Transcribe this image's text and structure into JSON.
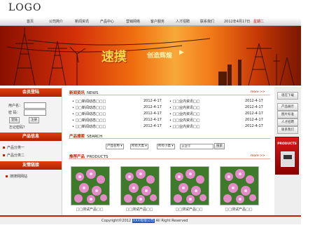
{
  "logo": "LOGO",
  "nav": {
    "items": [
      "首页",
      "公司简介",
      "新闻资讯",
      "产品中心",
      "营销网络",
      "客户服务",
      "人才招聘",
      "联系我们"
    ],
    "date": "2012年4月17日",
    "week": "星期二"
  },
  "banner": {
    "slogan_big": "速摸",
    "slogan_small": "创造辉煌",
    "arrow": "▶"
  },
  "sidebar": {
    "login": {
      "title": "会员登陆",
      "username_label": "用户名：",
      "password_label": "密 码：",
      "login_button": "登陆",
      "register_button": "注册",
      "forgot": "忘记密码？"
    },
    "products": {
      "title": "产品信息",
      "items": [
        "产品分类一",
        "产品分类二"
      ]
    },
    "links": {
      "title": "友情链接",
      "items": [
        "搜搜网网站"
      ]
    }
  },
  "news": {
    "title_cn": "新闻资讯",
    "title_en": "NEWS",
    "more": "more >>",
    "left": [
      {
        "title": "□□新闻动态□□□",
        "date": "2012-4-17"
      },
      {
        "title": "□□新闻动态□□□",
        "date": "2012-4-17"
      },
      {
        "title": "□□新闻动态□□□",
        "date": "2012-4-17"
      },
      {
        "title": "□□新闻动态□□□",
        "date": "2012-4-17"
      },
      {
        "title": "□□新闻动态□□□",
        "date": "2012-4-17"
      }
    ],
    "right": [
      {
        "title": "□□业内资讯□□",
        "date": "2012-4-17"
      },
      {
        "title": "□□业内资讯□□",
        "date": "2012-4-17"
      },
      {
        "title": "□□业内资讯□□",
        "date": "2012-4-17"
      },
      {
        "title": "□□业内资讯□□",
        "date": "2012-4-17"
      },
      {
        "title": "□□业内资讯□□",
        "date": "2012-4-17"
      }
    ]
  },
  "search": {
    "title_cn": "产品搜索",
    "title_en": "SEARCH",
    "select1": "产品名称",
    "select2": "所有大类",
    "select3": "所有小类",
    "placeholder": "关键字",
    "button": "搜索"
  },
  "products": {
    "title_cn": "推荐产品",
    "title_en": "PRODUCTS",
    "more": "more >>",
    "items": [
      "□□测试产品□□",
      "□□测试产品□□",
      "□□测试产品□□",
      "□□测试产品□□"
    ]
  },
  "right": {
    "buttons": [
      "现在下载",
      "产品展示",
      "图片标准",
      "人才招聘",
      "联系我们"
    ],
    "promo": "PRODUCTS"
  },
  "footer": {
    "prefix": "Copyright©2012",
    "company": "XXX有限公司",
    "suffix": "All Right Reserved"
  },
  "colors": {
    "accent": "#c02000",
    "banner": "#f07010"
  }
}
